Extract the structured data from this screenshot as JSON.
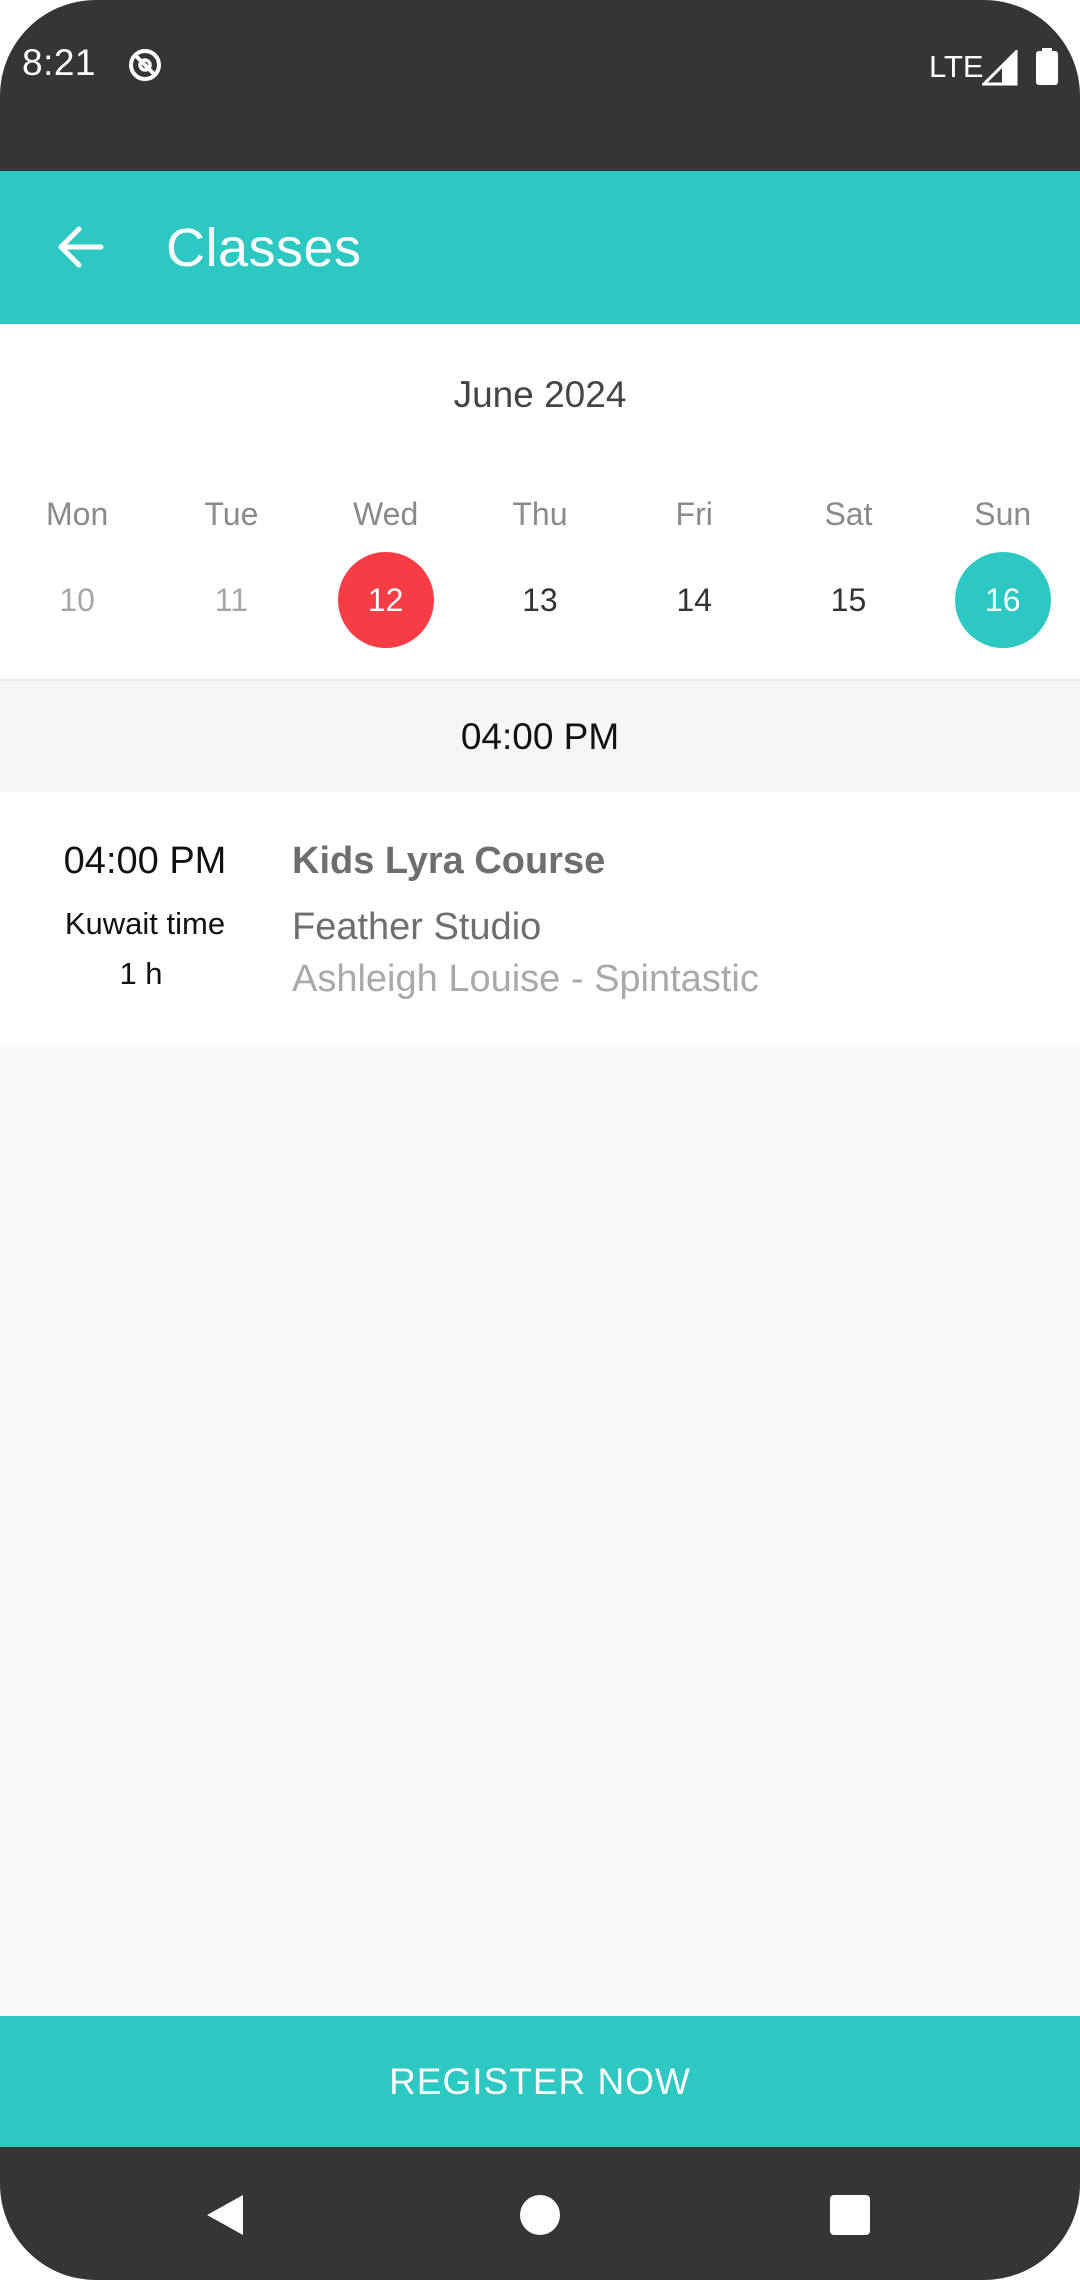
{
  "status_bar": {
    "time": "8:21",
    "network": "LTE",
    "icons": [
      "do-not-disturb-icon",
      "signal-icon",
      "battery-icon"
    ]
  },
  "app_bar": {
    "title": "Classes",
    "back_icon": "arrow-left-icon"
  },
  "calendar": {
    "month": "June 2024",
    "weekdays": [
      "Mon",
      "Tue",
      "Wed",
      "Thu",
      "Fri",
      "Sat",
      "Sun"
    ],
    "dates": [
      {
        "day": "10",
        "state": "past"
      },
      {
        "day": "11",
        "state": "past"
      },
      {
        "day": "12",
        "state": "today"
      },
      {
        "day": "13",
        "state": "normal"
      },
      {
        "day": "14",
        "state": "normal"
      },
      {
        "day": "15",
        "state": "normal"
      },
      {
        "day": "16",
        "state": "selected"
      }
    ]
  },
  "schedule": {
    "time_header": "04:00 PM",
    "classes": [
      {
        "time": "04:00 PM",
        "timezone": "Kuwait time",
        "duration": "1 h",
        "name": "Kids Lyra Course",
        "studio": "Feather Studio",
        "instructor": "Ashleigh Louise - Spintastic"
      }
    ]
  },
  "actions": {
    "register_label": "REGISTER NOW"
  },
  "colors": {
    "accent": "#2ec8c2",
    "today": "#f73c43",
    "status_bar": "#353437",
    "background": "#f8f8fa"
  },
  "nav_bar": {
    "icons": [
      "back-triangle-icon",
      "home-circle-icon",
      "recents-square-icon"
    ]
  }
}
